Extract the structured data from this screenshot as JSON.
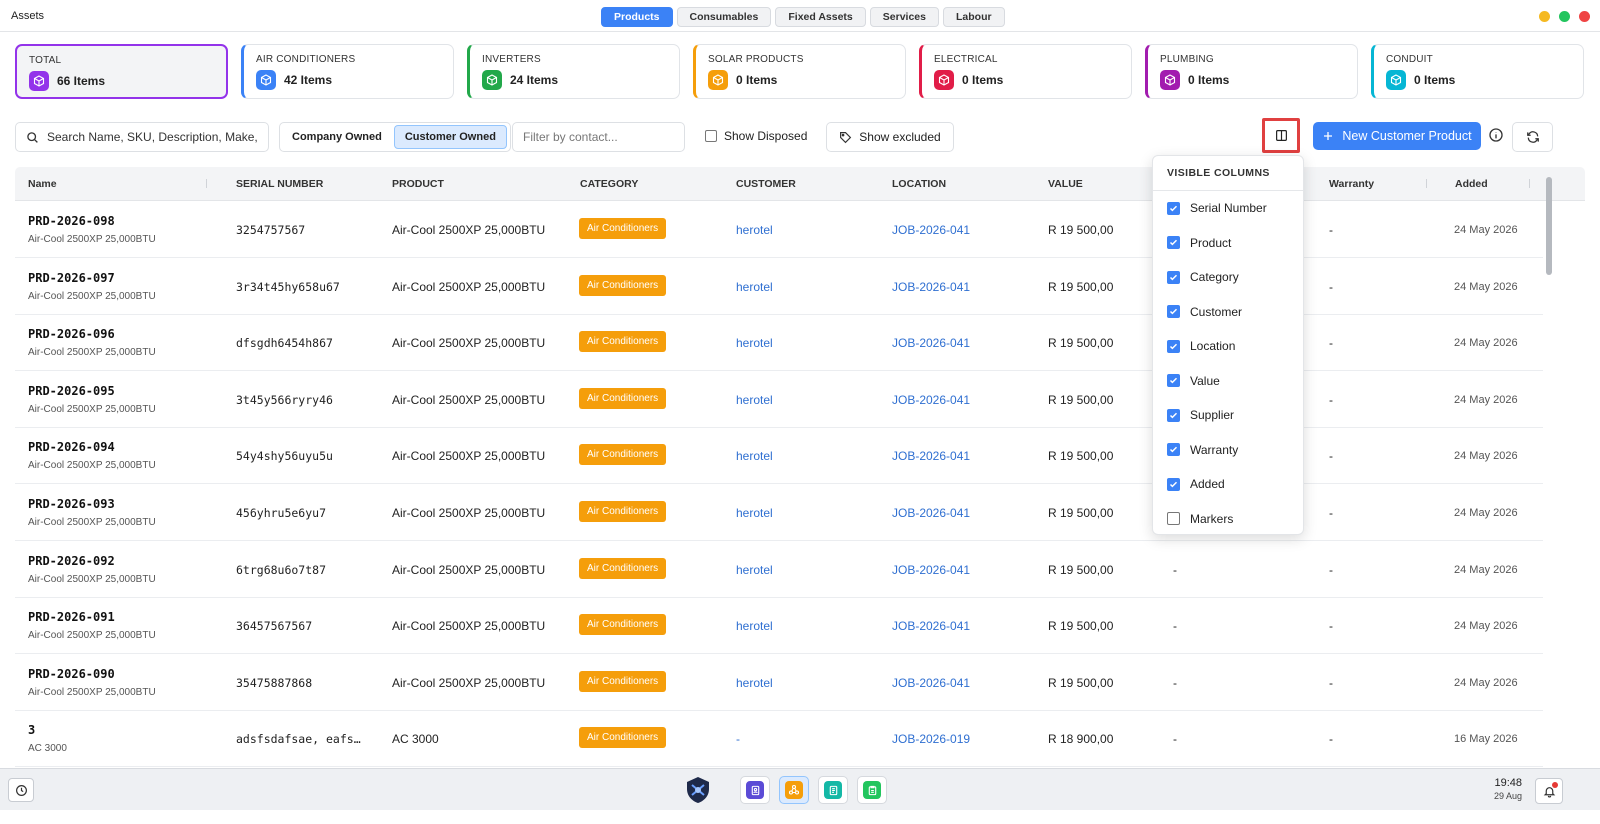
{
  "app": {
    "title": "Assets"
  },
  "tabs": [
    {
      "label": "Products",
      "active": true
    },
    {
      "label": "Consumables",
      "active": false
    },
    {
      "label": "Fixed Assets",
      "active": false
    },
    {
      "label": "Services",
      "active": false
    },
    {
      "label": "Labour",
      "active": false
    }
  ],
  "window_controls": [
    "#f5b921",
    "#22c55e",
    "#ef4444"
  ],
  "cards": [
    {
      "label": "TOTAL",
      "count": "66 Items",
      "color": "#9333ea"
    },
    {
      "label": "AIR CONDITIONERS",
      "count": "42 Items",
      "color": "#3b82f6"
    },
    {
      "label": "INVERTERS",
      "count": "24 Items",
      "color": "#22a84a"
    },
    {
      "label": "SOLAR PRODUCTS",
      "count": "0 Items",
      "color": "#f59e0b"
    },
    {
      "label": "ELECTRICAL",
      "count": "0 Items",
      "color": "#e11d48"
    },
    {
      "label": "PLUMBING",
      "count": "0 Items",
      "color": "#a21caf"
    },
    {
      "label": "CONDUIT",
      "count": "0 Items",
      "color": "#06b6d4"
    }
  ],
  "toolbar": {
    "search_placeholder": "Search Name, SKU, Description, Make,",
    "company_owned": "Company Owned",
    "customer_owned": "Customer Owned",
    "contact_placeholder": "Filter by contact...",
    "show_disposed": "Show Disposed",
    "show_excluded": "Show excluded",
    "new_button": "New Customer Product"
  },
  "columns": [
    "Name",
    "SERIAL NUMBER",
    "PRODUCT",
    "CATEGORY",
    "CUSTOMER",
    "LOCATION",
    "VALUE",
    "Warranty",
    "Added"
  ],
  "rows": [
    {
      "name": "PRD-2026-098",
      "sub": "Air-Cool 2500XP 25,000BTU",
      "serial": "3254757567",
      "product": "Air-Cool 2500XP 25,000BTU",
      "category": "Air Conditioners",
      "customer": "herotel",
      "location": "JOB-2026-041",
      "value": "R 19 500,00",
      "supplier": "",
      "warranty": "-",
      "added": "24 May 2026"
    },
    {
      "name": "PRD-2026-097",
      "sub": "Air-Cool 2500XP 25,000BTU",
      "serial": "3r34t45hy658u67",
      "product": "Air-Cool 2500XP 25,000BTU",
      "category": "Air Conditioners",
      "customer": "herotel",
      "location": "JOB-2026-041",
      "value": "R 19 500,00",
      "supplier": "",
      "warranty": "-",
      "added": "24 May 2026"
    },
    {
      "name": "PRD-2026-096",
      "sub": "Air-Cool 2500XP 25,000BTU",
      "serial": "dfsgdh6454h867",
      "product": "Air-Cool 2500XP 25,000BTU",
      "category": "Air Conditioners",
      "customer": "herotel",
      "location": "JOB-2026-041",
      "value": "R 19 500,00",
      "supplier": "",
      "warranty": "-",
      "added": "24 May 2026"
    },
    {
      "name": "PRD-2026-095",
      "sub": "Air-Cool 2500XP 25,000BTU",
      "serial": "3t45y566ryry46",
      "product": "Air-Cool 2500XP 25,000BTU",
      "category": "Air Conditioners",
      "customer": "herotel",
      "location": "JOB-2026-041",
      "value": "R 19 500,00",
      "supplier": "",
      "warranty": "-",
      "added": "24 May 2026"
    },
    {
      "name": "PRD-2026-094",
      "sub": "Air-Cool 2500XP 25,000BTU",
      "serial": "54y4shy56uyu5u",
      "product": "Air-Cool 2500XP 25,000BTU",
      "category": "Air Conditioners",
      "customer": "herotel",
      "location": "JOB-2026-041",
      "value": "R 19 500,00",
      "supplier": "",
      "warranty": "-",
      "added": "24 May 2026"
    },
    {
      "name": "PRD-2026-093",
      "sub": "Air-Cool 2500XP 25,000BTU",
      "serial": "456yhru5e6yu7",
      "product": "Air-Cool 2500XP 25,000BTU",
      "category": "Air Conditioners",
      "customer": "herotel",
      "location": "JOB-2026-041",
      "value": "R 19 500,00",
      "supplier": "",
      "warranty": "-",
      "added": "24 May 2026"
    },
    {
      "name": "PRD-2026-092",
      "sub": "Air-Cool 2500XP 25,000BTU",
      "serial": "6trg68u6o7t87",
      "product": "Air-Cool 2500XP 25,000BTU",
      "category": "Air Conditioners",
      "customer": "herotel",
      "location": "JOB-2026-041",
      "value": "R 19 500,00",
      "supplier": "-",
      "warranty": "-",
      "added": "24 May 2026"
    },
    {
      "name": "PRD-2026-091",
      "sub": "Air-Cool 2500XP 25,000BTU",
      "serial": "36457567567",
      "product": "Air-Cool 2500XP 25,000BTU",
      "category": "Air Conditioners",
      "customer": "herotel",
      "location": "JOB-2026-041",
      "value": "R 19 500,00",
      "supplier": "-",
      "warranty": "-",
      "added": "24 May 2026"
    },
    {
      "name": "PRD-2026-090",
      "sub": "Air-Cool 2500XP 25,000BTU",
      "serial": "35475887868",
      "product": "Air-Cool 2500XP 25,000BTU",
      "category": "Air Conditioners",
      "customer": "herotel",
      "location": "JOB-2026-041",
      "value": "R 19 500,00",
      "supplier": "-",
      "warranty": "-",
      "added": "24 May 2026"
    },
    {
      "name": "3",
      "sub": "AC 3000",
      "serial": "adsfsdafsae, eafs…",
      "product": "AC 3000",
      "category": "Air Conditioners",
      "customer": "-",
      "location": "JOB-2026-019",
      "value": "R 18 900,00",
      "supplier": "-",
      "warranty": "-",
      "added": "16 May 2026"
    }
  ],
  "visible_columns": {
    "title": "VISIBLE COLUMNS",
    "items": [
      {
        "label": "Serial Number",
        "checked": true
      },
      {
        "label": "Product",
        "checked": true
      },
      {
        "label": "Category",
        "checked": true
      },
      {
        "label": "Customer",
        "checked": true
      },
      {
        "label": "Location",
        "checked": true
      },
      {
        "label": "Value",
        "checked": true
      },
      {
        "label": "Supplier",
        "checked": true
      },
      {
        "label": "Warranty",
        "checked": true
      },
      {
        "label": "Added",
        "checked": true
      },
      {
        "label": "Markers",
        "checked": false
      }
    ]
  },
  "taskbar": {
    "time": "19:48",
    "date": "29 Aug",
    "apps": [
      {
        "icon": "contacts-icon",
        "color": "#5b4bd6",
        "active": false
      },
      {
        "icon": "network-icon",
        "color": "#f59e0b",
        "active": true
      },
      {
        "icon": "document-icon",
        "color": "#14b8a6",
        "active": false
      },
      {
        "icon": "clipboard-icon",
        "color": "#22c55e",
        "active": false
      }
    ]
  }
}
